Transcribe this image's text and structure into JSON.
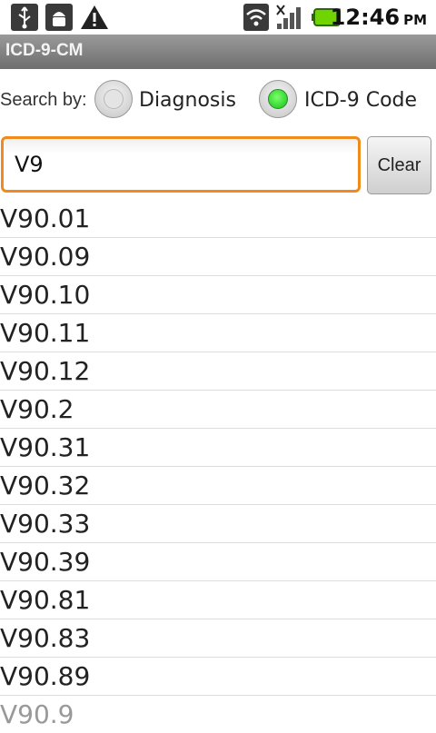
{
  "status_bar": {
    "icons": [
      "usb-icon",
      "android-debug-icon",
      "warning-icon",
      "wifi-icon",
      "signal-icon",
      "battery-icon"
    ],
    "time": "12:46",
    "ampm": "PM"
  },
  "app": {
    "title": "ICD-9-CM"
  },
  "search": {
    "label": "Search by:",
    "options": [
      {
        "label": "Diagnosis",
        "selected": false
      },
      {
        "label": "ICD-9 Code",
        "selected": true
      }
    ],
    "query": "V9",
    "clear_label": "Clear"
  },
  "results": [
    "V90.01",
    "V90.09",
    "V90.10",
    "V90.11",
    "V90.12",
    "V90.2",
    "V90.31",
    "V90.32",
    "V90.33",
    "V90.39",
    "V90.81",
    "V90.83",
    "V90.89",
    "V90.9"
  ],
  "colors": {
    "accent": "#f08a1c",
    "radio_on": "#0fc21a",
    "title_bar": "#7d7d7d"
  }
}
